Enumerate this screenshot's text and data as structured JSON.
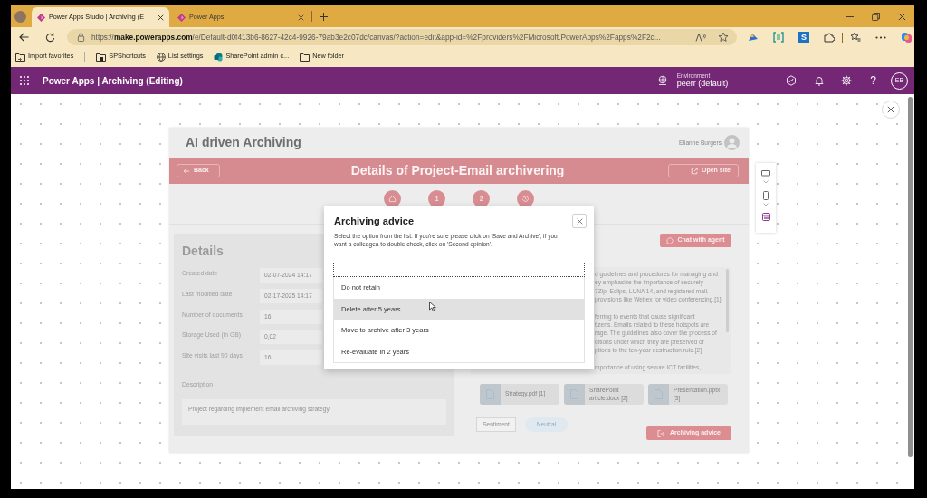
{
  "browser": {
    "tabs": [
      {
        "title": "Power Apps Studio | Archiving (E",
        "selected": true
      },
      {
        "title": "Power Apps",
        "selected": false
      }
    ],
    "address": "https://**make.powerapps.com**/e/Default-d0f413b6-8627-42c4-9926-79ab3e2c07dc/canvas/?action=edit&app-id=%2Fproviders%2FMicrosoft.PowerApps%2Fapps%2F2c...",
    "extension_tile": "S",
    "bookmarks": [
      {
        "kind": "import",
        "label": "Import favorites"
      },
      {
        "kind": "shortcut",
        "label": "SPShortcuts"
      },
      {
        "kind": "globe",
        "label": "List settings"
      },
      {
        "kind": "site",
        "label": "SharePoint admin c..."
      },
      {
        "kind": "folder",
        "label": "New folder"
      }
    ]
  },
  "app_bar": {
    "title": "Power Apps | Archiving (Editing)",
    "environment_label": "Environment",
    "environment": "peerr (default)",
    "help": "?",
    "user_initials": "EB"
  },
  "app": {
    "title": "AI driven Archiving",
    "user": "Elianne Burgers",
    "back": "Back",
    "page_title": "Details of Project-Email archivering",
    "open_site": "Open site",
    "steps": [
      {
        "kind": "home"
      },
      {
        "kind": "number",
        "label": "1"
      },
      {
        "kind": "number",
        "label": "2"
      },
      {
        "kind": "history"
      }
    ],
    "details": {
      "heading": "Details",
      "fields": [
        {
          "label": "Created date",
          "value": "02-07-2024 14:17"
        },
        {
          "label": "Last modified date",
          "value": "02-17-2025 14:17"
        },
        {
          "label": "Number of documents",
          "value": "16"
        },
        {
          "label": "Storage Used (in GB)",
          "value": "0,02"
        },
        {
          "label": "Site visits last 90 days",
          "value": "16"
        }
      ],
      "description_label": "Description",
      "description": "Project regarding implement email archiving strategy"
    },
    "chat_button": "Chat with agent",
    "summary": [
      [
        "d guidelines and procedures for managing and",
        "ey emphasize the importance of securely",
        "7Zip, Eclips, LUNA 14, and registered mail.",
        "provisions like Webex for video conferencing.[1]"
      ],
      [
        "ferring to events that cause significant",
        "tizens. Emails related to these hotspots are",
        "rage. The guidelines also cover the process of",
        "ditions under which they are preserved or",
        "ptions to the ten-year destruction rule.[2]"
      ],
      [
        "mportance of using secure ICT facilities,"
      ]
    ],
    "sources": [
      {
        "lines": [
          "Strategy.pdf [1]"
        ]
      },
      {
        "lines": [
          "SharePoint",
          "article.docx [2]"
        ]
      },
      {
        "lines": [
          "Presentation.pptx",
          "[3]"
        ]
      }
    ],
    "sentiment_label": "Sentiment",
    "sentiment": "Neutral",
    "advice_button": "Archiving advice"
  },
  "modal": {
    "title": "Archiving advice",
    "text": [
      "Select the option from the list. If you're sure please click on 'Save and Archive', if you",
      "want a colleagea to double check, click on 'Second opinion'."
    ],
    "options": [
      {
        "label": "Do not retain",
        "selected": false
      },
      {
        "label": "Delete after 5 years",
        "selected": true
      },
      {
        "label": "Move to archive after 3 years",
        "selected": false
      },
      {
        "label": "Re-evaluate in 2 years",
        "selected": false
      }
    ]
  }
}
